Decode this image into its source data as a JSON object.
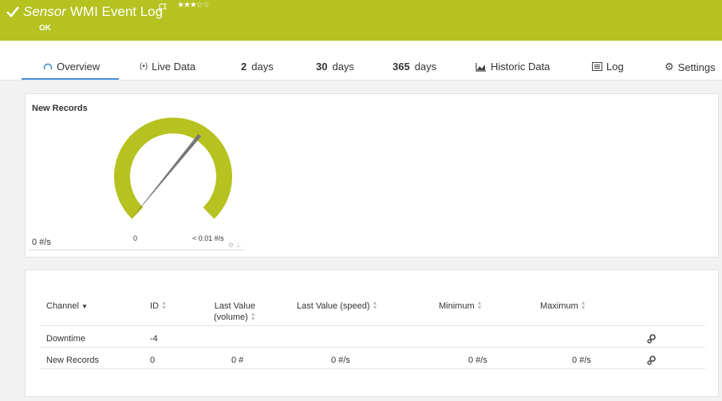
{
  "header": {
    "sensor_type": "Sensor",
    "title": "WMI Event Log",
    "status": "OK",
    "priority_stars": "★★★☆☆",
    "accent_color": "#b5c21f"
  },
  "tabs": [
    {
      "label": "Overview",
      "icon": "gauge-icon",
      "active": true
    },
    {
      "label": "Live Data",
      "icon": "live-data-icon"
    },
    {
      "prefix": "2",
      "label": "days"
    },
    {
      "prefix": "30",
      "label": "days"
    },
    {
      "prefix": "365",
      "label": "days"
    },
    {
      "label": "Historic Data",
      "icon": "area-chart-icon"
    },
    {
      "label": "Log",
      "icon": "log-icon"
    },
    {
      "label": "Settings",
      "icon": "gear-icon"
    }
  ],
  "gauge": {
    "title": "New Records",
    "value": "0 #/s",
    "min_label": "0",
    "max_label": "< 0.01 #/s",
    "fraction": 0.62
  },
  "table": {
    "columns": [
      {
        "label": "Channel",
        "sort": "desc"
      },
      {
        "label": "ID"
      },
      {
        "label": "Last Value",
        "label2": "(volume)"
      },
      {
        "label": "Last Value (speed)"
      },
      {
        "label": "Minimum"
      },
      {
        "label": "Maximum"
      }
    ],
    "rows": [
      {
        "channel": "Downtime",
        "id": "-4",
        "volume": "",
        "speed": "",
        "minimum": "",
        "maximum": ""
      },
      {
        "channel": "New Records",
        "id": "0",
        "volume": "0 #",
        "speed": "0 #/s",
        "minimum": "0 #/s",
        "maximum": "0 #/s"
      }
    ]
  }
}
